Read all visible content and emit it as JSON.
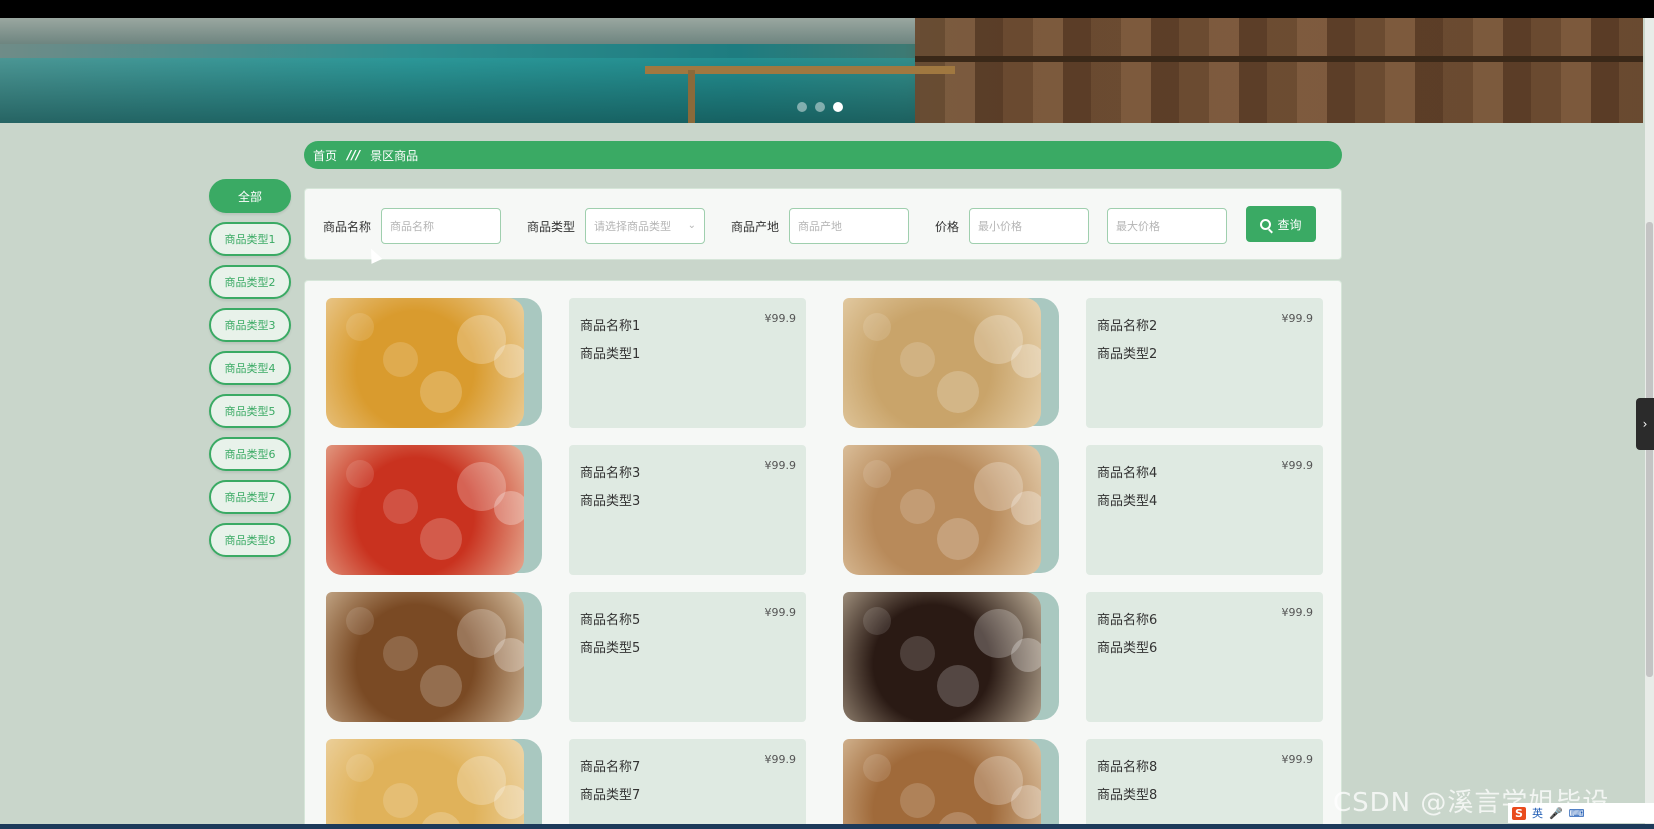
{
  "banner": {
    "dots": [
      false,
      false,
      true
    ]
  },
  "breadcrumb": {
    "home": "首页",
    "separator": "///",
    "current": "景区商品"
  },
  "categories": [
    {
      "label": "全部",
      "active": true
    },
    {
      "label": "商品类型1",
      "active": false
    },
    {
      "label": "商品类型2",
      "active": false
    },
    {
      "label": "商品类型3",
      "active": false
    },
    {
      "label": "商品类型4",
      "active": false
    },
    {
      "label": "商品类型5",
      "active": false
    },
    {
      "label": "商品类型6",
      "active": false
    },
    {
      "label": "商品类型7",
      "active": false
    },
    {
      "label": "商品类型8",
      "active": false
    }
  ],
  "search": {
    "name_label": "商品名称",
    "name_placeholder": "商品名称",
    "type_label": "商品类型",
    "type_placeholder": "请选择商品类型",
    "origin_label": "商品产地",
    "origin_placeholder": "商品产地",
    "price_label": "价格",
    "min_price_placeholder": "最小价格",
    "max_price_placeholder": "最大价格",
    "query_button": "查询"
  },
  "products": [
    {
      "name": "商品名称1",
      "type": "商品类型1",
      "price": "¥99.9",
      "image": "chocolate-balls",
      "color": "#d99b2e"
    },
    {
      "name": "商品名称2",
      "type": "商品类型2",
      "price": "¥99.9",
      "image": "sesame-brittle",
      "color": "#c9a46a"
    },
    {
      "name": "商品名称3",
      "type": "商品类型3",
      "price": "¥99.9",
      "image": "gift-box-snacks",
      "color": "#c9321f"
    },
    {
      "name": "商品名称4",
      "type": "商品类型4",
      "price": "¥99.9",
      "image": "cashews",
      "color": "#b88a5a"
    },
    {
      "name": "商品名称5",
      "type": "商品类型5",
      "price": "¥99.9",
      "image": "roast-duck",
      "color": "#7a4a24"
    },
    {
      "name": "商品名称6",
      "type": "商品类型6",
      "price": "¥99.9",
      "image": "cured-ham",
      "color": "#2a1a14"
    },
    {
      "name": "商品名称7",
      "type": "商品类型7",
      "price": "¥99.9",
      "image": "steamed-bun-corn",
      "color": "#e0b25a"
    },
    {
      "name": "商品名称8",
      "type": "商品类型8",
      "price": "¥99.9",
      "image": "hazelnuts",
      "color": "#a06a3a"
    }
  ],
  "watermark": "CSDN @溪言学姐毕设",
  "ime": {
    "logo": "S",
    "mode": "英"
  }
}
